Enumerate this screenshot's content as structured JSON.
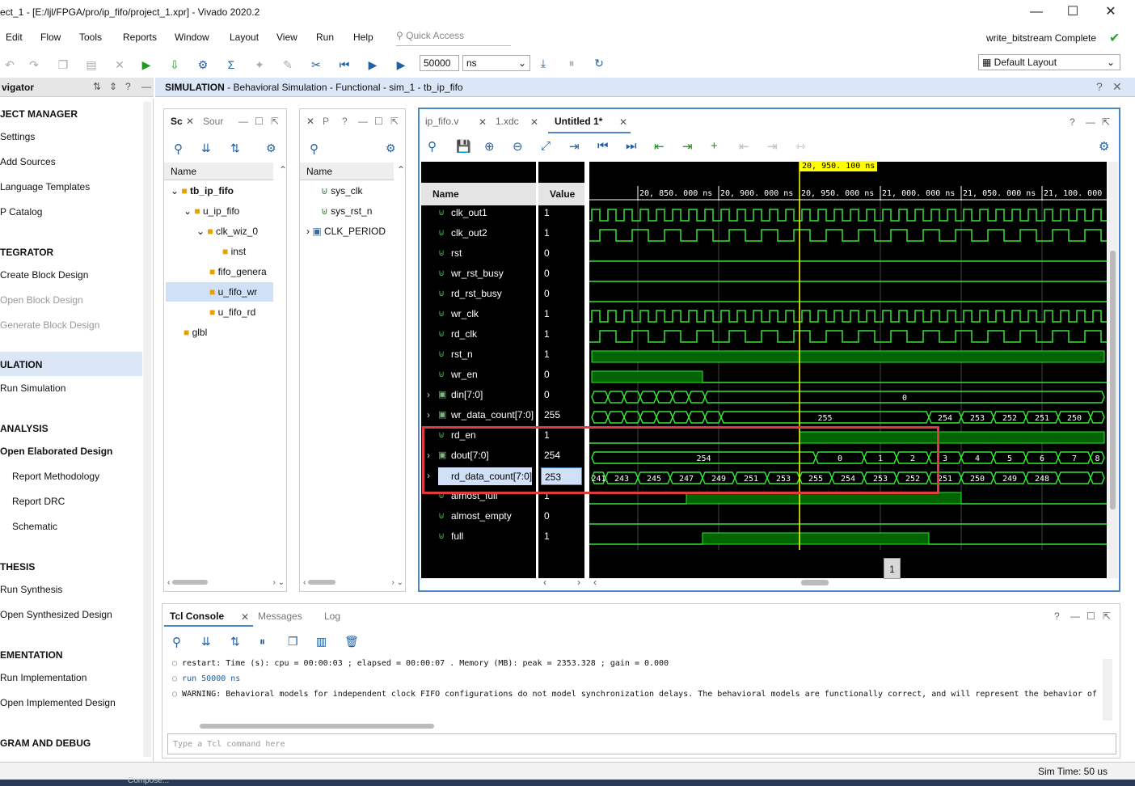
{
  "window": {
    "title": "ect_1 - [E:/ljl/FPGA/pro/ip_fifo/project_1.xpr] - Vivado 2020.2",
    "min": "—",
    "max": "☐",
    "close": "✕"
  },
  "menu": [
    "Edit",
    "Flow",
    "Tools",
    "Reports",
    "Window",
    "Layout",
    "View",
    "Run",
    "Help"
  ],
  "quick_access": {
    "placeholder": "Quick Access"
  },
  "status_right": {
    "text": "write_bitstream Complete"
  },
  "toolbar": {
    "run_time": "50000",
    "unit": "ns",
    "layout": "Default Layout"
  },
  "flow_nav": {
    "title": "vigator",
    "items": [
      {
        "label": "JECT MANAGER",
        "type": "section"
      },
      {
        "label": "Settings",
        "type": "item"
      },
      {
        "label": "Add Sources",
        "type": "item"
      },
      {
        "label": "Language Templates",
        "type": "item"
      },
      {
        "label": "P Catalog",
        "type": "item"
      },
      {
        "label": "TEGRATOR",
        "type": "section"
      },
      {
        "label": "Create Block Design",
        "type": "item"
      },
      {
        "label": "Open Block Design",
        "type": "disabled"
      },
      {
        "label": "Generate Block Design",
        "type": "disabled"
      },
      {
        "label": "ULATION",
        "type": "active"
      },
      {
        "label": "Run Simulation",
        "type": "item"
      },
      {
        "label": "ANALYSIS",
        "type": "section"
      },
      {
        "label": "Open Elaborated Design",
        "type": "bold"
      },
      {
        "label": "Report Methodology",
        "type": "sub"
      },
      {
        "label": "Report DRC",
        "type": "sub"
      },
      {
        "label": "Schematic",
        "type": "sub"
      },
      {
        "label": "THESIS",
        "type": "section"
      },
      {
        "label": "Run Synthesis",
        "type": "item"
      },
      {
        "label": "Open Synthesized Design",
        "type": "item"
      },
      {
        "label": "EMENTATION",
        "type": "section"
      },
      {
        "label": "Run Implementation",
        "type": "item"
      },
      {
        "label": "Open Implemented Design",
        "type": "item"
      },
      {
        "label": "GRAM AND DEBUG",
        "type": "section"
      }
    ]
  },
  "sim_header": {
    "bold": "SIMULATION",
    "rest": " - Behavioral Simulation - Functional - sim_1 - tb_ip_fifo"
  },
  "scope_panel": {
    "tabs": [
      "Sc",
      "Sour"
    ],
    "name_header": "Name",
    "tree": [
      "tb_ip_fifo",
      "u_ip_fifo",
      "clk_wiz_0",
      "inst",
      "fifo_genera",
      "u_fifo_wr",
      "u_fifo_rd",
      "glbl"
    ]
  },
  "objects_panel": {
    "tab": "P",
    "name_header": "Name",
    "items": [
      "sys_clk",
      "sys_rst_n",
      "CLK_PERIOD"
    ]
  },
  "wave_tabs": [
    "ip_fifo.v",
    "1.xdc",
    "Untitled 1*"
  ],
  "wave": {
    "name_header": "Name",
    "value_header": "Value",
    "cursor_label": "20, 950. 100  ns",
    "time_labels": [
      "20, 850. 000  ns",
      "20, 900. 000  ns",
      "20, 950. 000  ns",
      "21, 000. 000  ns",
      "21, 050. 000  ns",
      "21, 100. 000  ns"
    ],
    "signals": [
      {
        "name": "clk_out1",
        "value": "1"
      },
      {
        "name": "clk_out2",
        "value": "1"
      },
      {
        "name": "rst",
        "value": "0"
      },
      {
        "name": "wr_rst_busy",
        "value": "0"
      },
      {
        "name": "rd_rst_busy",
        "value": "0"
      },
      {
        "name": "wr_clk",
        "value": "1"
      },
      {
        "name": "rd_clk",
        "value": "1"
      },
      {
        "name": "rst_n",
        "value": "1"
      },
      {
        "name": "wr_en",
        "value": "0"
      },
      {
        "name": "din[7:0]",
        "value": "0"
      },
      {
        "name": "wr_data_count[7:0]",
        "value": "255"
      },
      {
        "name": "rd_en",
        "value": "1"
      },
      {
        "name": "dout[7:0]",
        "value": "254"
      },
      {
        "name": "rd_data_count[7:0]",
        "value": "253"
      },
      {
        "name": "almost_full",
        "value": "1"
      },
      {
        "name": "almost_empty",
        "value": "0"
      },
      {
        "name": "full",
        "value": "1"
      }
    ],
    "bus_labels": {
      "din": "0",
      "wr_count": [
        "255",
        "254",
        "253",
        "252",
        "251",
        "250"
      ],
      "dout": [
        "254",
        "0",
        "1",
        "2",
        "3",
        "4",
        "5",
        "6",
        "7",
        "8"
      ],
      "rd_count": [
        "241",
        "243",
        "245",
        "247",
        "249",
        "251",
        "253",
        "255",
        "254",
        "253",
        "252",
        "251",
        "250",
        "249",
        "248"
      ]
    },
    "page_marker": "1"
  },
  "console": {
    "tabs": [
      "Tcl Console",
      "Messages",
      "Log"
    ],
    "lines": [
      "restart: Time (s): cpu = 00:00:03 ; elapsed = 00:00:07 . Memory (MB): peak = 2353.328 ; gain = 0.000",
      "run 50000 ns",
      "WARNING: Behavioral models for independent clock FIFO configurations do not model synchronization delays. The behavioral models are functionally correct, and will represent the behavior of"
    ],
    "input_placeholder": "Type a Tcl command here"
  },
  "status": {
    "sim_time": "Sim Time: 50 us"
  },
  "taskbar": {
    "item": "Compose..."
  }
}
